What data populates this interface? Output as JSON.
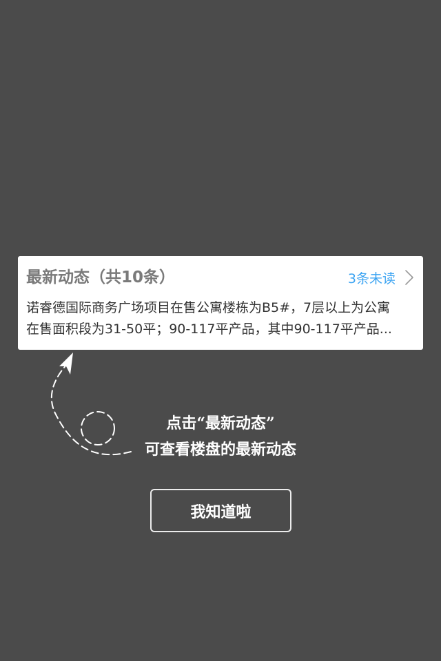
{
  "news_card": {
    "title": "最新动态（共10条）",
    "unread": "3条未读",
    "body_lines": [
      "诺睿德国际商务广场项目在售公寓楼栋为B5#，7层以上为公寓",
      "在售面积段为31-50平；90-117平产品，其中90-117平产品..."
    ]
  },
  "guide": {
    "hint_lines": [
      "点击“最新动态”",
      "可查看楼盘的最新动态"
    ]
  },
  "ok_button": {
    "label": "我知道啦"
  },
  "colors": {
    "overlay_background": "#4b4b4b",
    "card_background": "#ffffff",
    "title_text": "#7a7a7a",
    "unread_accent": "#3aa3f2",
    "body_text": "#333333"
  },
  "icons": {
    "unread_chevron": "chevron-right-icon",
    "guide_pointer": "dashed-arrow-icon"
  }
}
